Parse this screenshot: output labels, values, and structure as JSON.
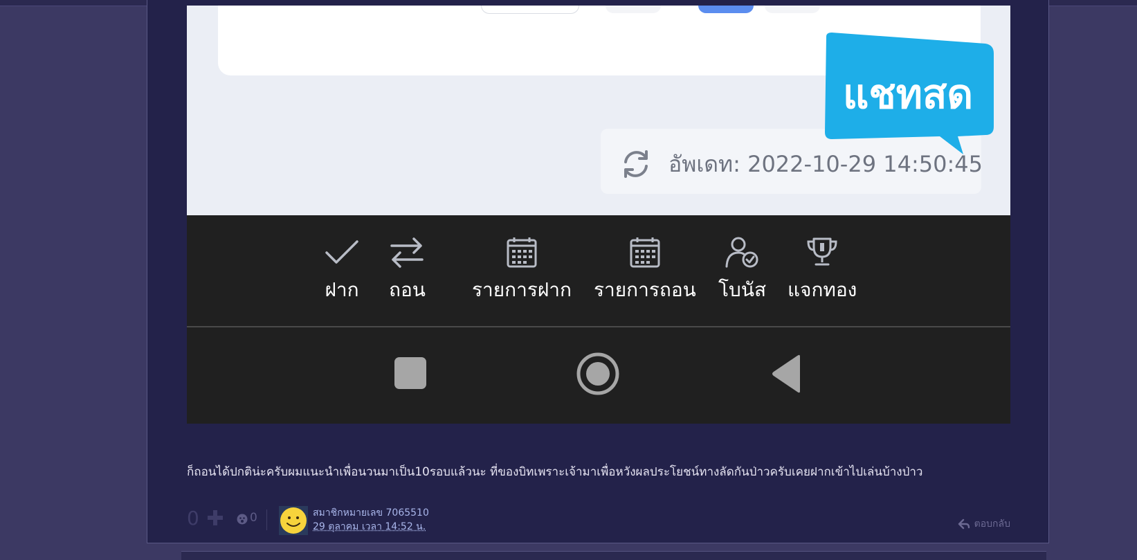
{
  "screenshot": {
    "update_text": "อัพเดท: 2022-10-29 14:50:45",
    "chat_badge": "แชทสด",
    "nav_items": [
      {
        "label": "ฝาก",
        "icon": "check-icon"
      },
      {
        "label": "ถอน",
        "icon": "transfer-arrows-icon"
      },
      {
        "label": "รายการฝาก",
        "icon": "calendar-icon"
      },
      {
        "label": "รายการถอน",
        "icon": "calendar-icon"
      },
      {
        "label": "โบนัส",
        "icon": "user-check-icon"
      },
      {
        "label": "แจกทอง",
        "icon": "trophy-icon"
      }
    ],
    "system_nav": [
      "recent-apps-square-icon",
      "home-circle-icon",
      "back-triangle-icon"
    ]
  },
  "post": {
    "text": "ก็ถอนได้ปกติน่ะครับผมแนะนำเพื่อนวนมาเป็น10รอบแล้วนะ ที่ของบิทเพราะเจ้ามาเพื่อหวังผลประโยชน์ทางลัดกันป่าวครับเคยฝากเข้าไปเล่นบ้างป่าว",
    "vote_count": "0",
    "emotion_count": "0",
    "member_name": "สมาชิกหมายเลข 7065510",
    "date": "29 ตุลาคม เวลา 14:52 น.",
    "reply_label": "ตอบกลับ"
  },
  "colors": {
    "page_bg": "#3c3963",
    "post_bg": "#23224a",
    "chat_badge": "#1eaee8",
    "nav_dark": "#202020",
    "link": "#a9b6ea"
  }
}
